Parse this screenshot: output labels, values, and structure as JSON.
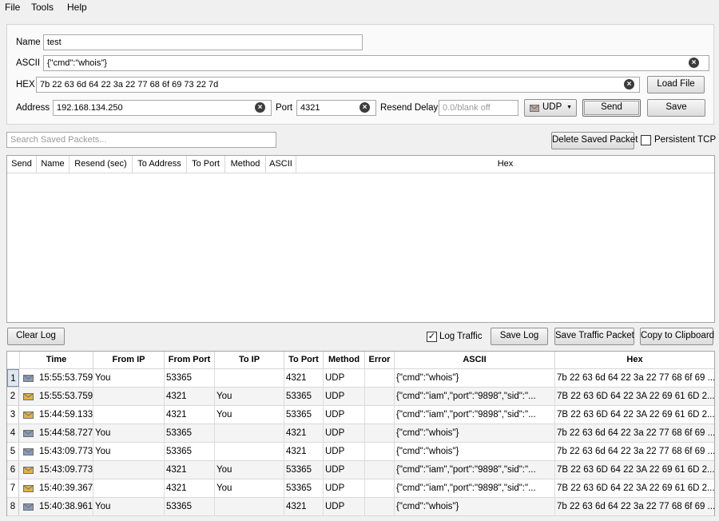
{
  "menu": {
    "file": "File",
    "tools": "Tools",
    "help": "Help"
  },
  "form": {
    "name_label": "Name",
    "name_value": "test",
    "ascii_label": "ASCII",
    "ascii_value": "{\"cmd\":\"whois\"}",
    "hex_label": "HEX",
    "hex_value": "7b 22 63 6d 64 22 3a 22 77 68 6f 69 73 22 7d",
    "address_label": "Address",
    "address_value": "192.168.134.250",
    "port_label": "Port",
    "port_value": "4321",
    "resend_label": "Resend Delay",
    "resend_placeholder": "0.0/blank off",
    "protocol_value": "UDP",
    "load_file": "Load File",
    "send": "Send",
    "save": "Save"
  },
  "saved": {
    "search_placeholder": "Search Saved Packets...",
    "delete_button": "Delete Saved Packet",
    "persistent_tcp": "Persistent TCP",
    "columns": [
      "Send",
      "Name",
      "Resend (sec)",
      "To Address",
      "To Port",
      "Method",
      "ASCII",
      "Hex"
    ]
  },
  "log_toolbar": {
    "clear_log": "Clear Log",
    "log_traffic": "Log Traffic",
    "log_traffic_checked": true,
    "save_log": "Save Log",
    "save_traffic_packet": "Save Traffic Packet",
    "copy_to_clipboard": "Copy to Clipboard"
  },
  "log": {
    "columns": [
      "Time",
      "From IP",
      "From Port",
      "To IP",
      "To Port",
      "Method",
      "Error",
      "ASCII",
      "Hex"
    ],
    "rows": [
      {
        "num": "1",
        "dir": "out",
        "time": "15:55:53.759",
        "from_ip": "You",
        "from_port": "53365",
        "to_ip": "",
        "to_port": "4321",
        "method": "UDP",
        "error": "",
        "ascii": "{\"cmd\":\"whois\"}",
        "hex": "7b 22 63 6d 64 22 3a 22 77 68 6f 69 ..."
      },
      {
        "num": "2",
        "dir": "in",
        "time": "15:55:53.759",
        "from_ip": "",
        "from_port": "4321",
        "to_ip": "You",
        "to_port": "53365",
        "method": "UDP",
        "error": "",
        "ascii": "{\"cmd\":\"iam\",\"port\":\"9898\",\"sid\":\"...",
        "hex": "7B 22 63 6D 64 22 3A 22 69 61 6D 2..."
      },
      {
        "num": "3",
        "dir": "in",
        "time": "15:44:59.133",
        "from_ip": "",
        "from_port": "4321",
        "to_ip": "You",
        "to_port": "53365",
        "method": "UDP",
        "error": "",
        "ascii": "{\"cmd\":\"iam\",\"port\":\"9898\",\"sid\":\"...",
        "hex": "7B 22 63 6D 64 22 3A 22 69 61 6D 2..."
      },
      {
        "num": "4",
        "dir": "out",
        "time": "15:44:58.727",
        "from_ip": "You",
        "from_port": "53365",
        "to_ip": "",
        "to_port": "4321",
        "method": "UDP",
        "error": "",
        "ascii": "{\"cmd\":\"whois\"}",
        "hex": "7b 22 63 6d 64 22 3a 22 77 68 6f 69 ..."
      },
      {
        "num": "5",
        "dir": "out",
        "time": "15:43:09.773",
        "from_ip": "You",
        "from_port": "53365",
        "to_ip": "",
        "to_port": "4321",
        "method": "UDP",
        "error": "",
        "ascii": "{\"cmd\":\"whois\"}",
        "hex": "7b 22 63 6d 64 22 3a 22 77 68 6f 69 ..."
      },
      {
        "num": "6",
        "dir": "in",
        "time": "15:43:09.773",
        "from_ip": "",
        "from_port": "4321",
        "to_ip": "You",
        "to_port": "53365",
        "method": "UDP",
        "error": "",
        "ascii": "{\"cmd\":\"iam\",\"port\":\"9898\",\"sid\":\"...",
        "hex": "7B 22 63 6D 64 22 3A 22 69 61 6D 2..."
      },
      {
        "num": "7",
        "dir": "in",
        "time": "15:40:39.367",
        "from_ip": "",
        "from_port": "4321",
        "to_ip": "You",
        "to_port": "53365",
        "method": "UDP",
        "error": "",
        "ascii": "{\"cmd\":\"iam\",\"port\":\"9898\",\"sid\":\"...",
        "hex": "7B 22 63 6D 64 22 3A 22 69 61 6D 2..."
      },
      {
        "num": "8",
        "dir": "out",
        "time": "15:40:38.961",
        "from_ip": "You",
        "from_port": "53365",
        "to_ip": "",
        "to_port": "4321",
        "method": "UDP",
        "error": "",
        "ascii": "{\"cmd\":\"whois\"}",
        "hex": "7b 22 63 6d 64 22 3a 22 77 68 6f 69 ..."
      }
    ]
  },
  "icons": {
    "outgoing": "envelope-out-icon",
    "incoming": "envelope-in-icon",
    "clear": "clear-x-icon",
    "dropdown": "chevron-down-icon"
  },
  "colors": {
    "outgoing": "#8a9bb8",
    "incoming": "#e0b24a",
    "selection": "#7a90ac"
  }
}
